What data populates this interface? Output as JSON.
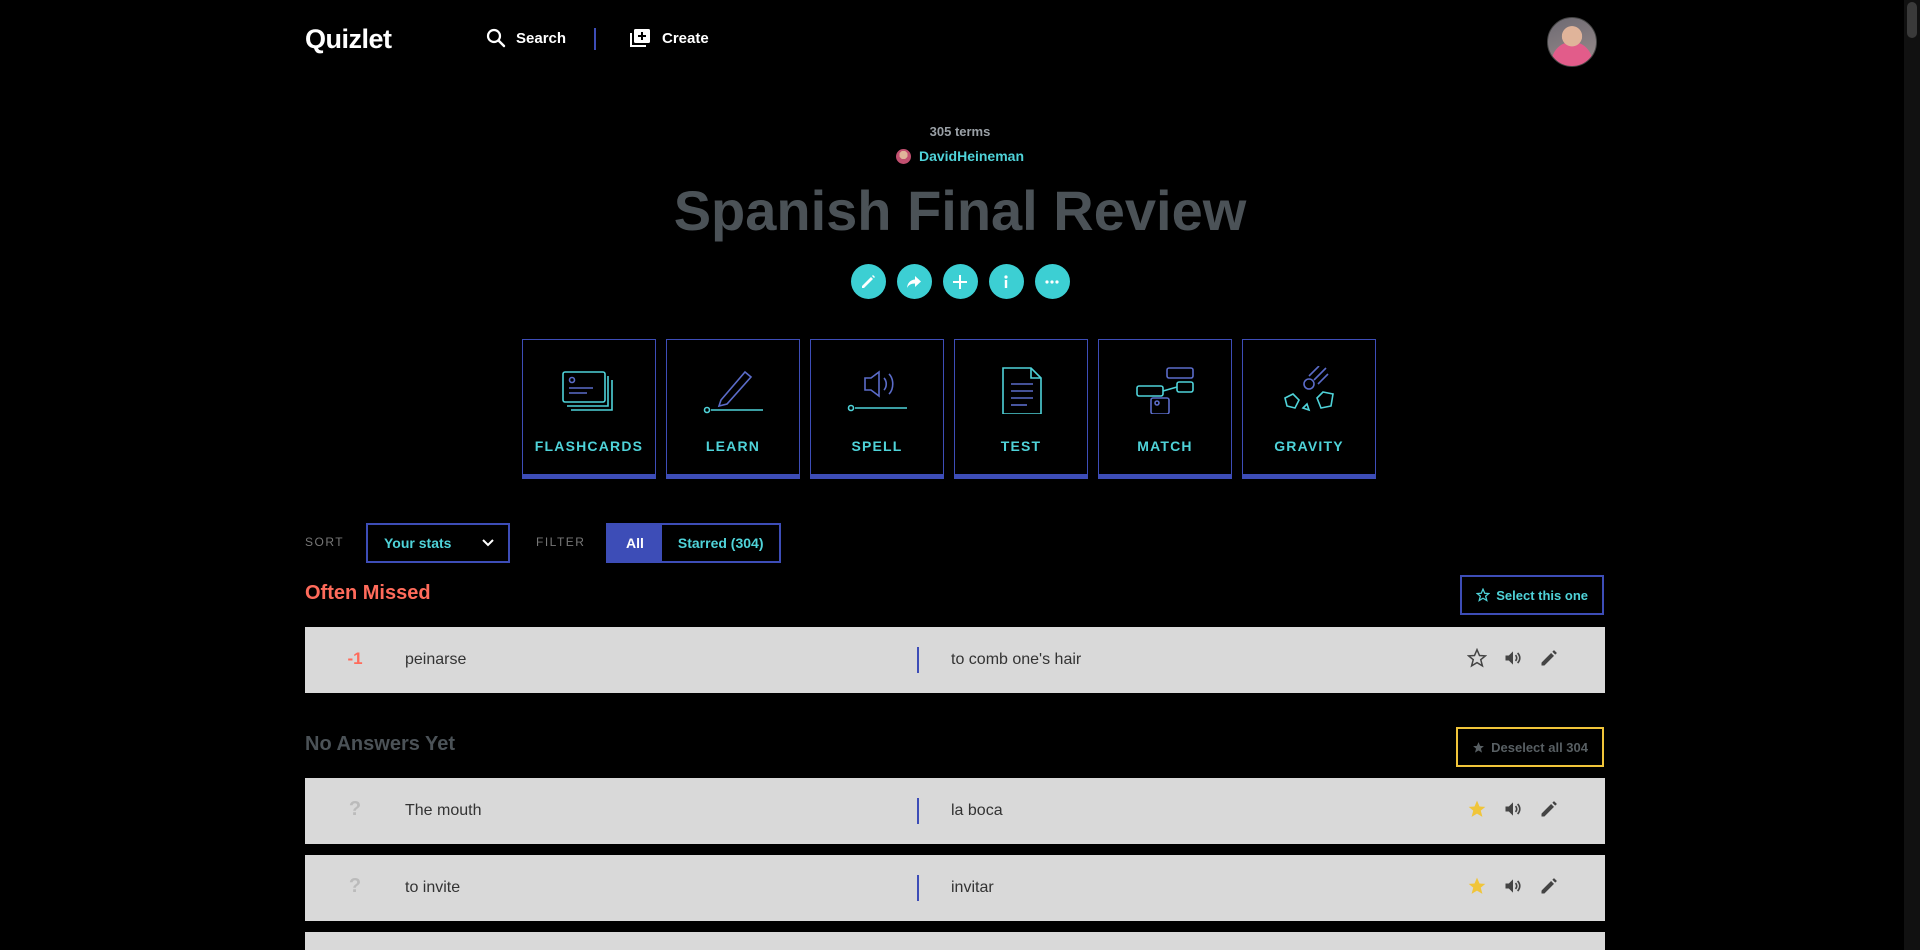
{
  "header": {
    "logo": "Quizlet",
    "search_label": "Search",
    "create_label": "Create"
  },
  "set": {
    "term_count": "305 terms",
    "author": "DavidHeineman",
    "title": "Spanish Final Review"
  },
  "modes": [
    {
      "label": "FLASHCARDS",
      "icon": "flashcards-icon"
    },
    {
      "label": "LEARN",
      "icon": "learn-icon"
    },
    {
      "label": "SPELL",
      "icon": "spell-icon"
    },
    {
      "label": "TEST",
      "icon": "test-icon"
    },
    {
      "label": "MATCH",
      "icon": "match-icon"
    },
    {
      "label": "GRAVITY",
      "icon": "gravity-icon"
    }
  ],
  "controls": {
    "sort_label": "SORT",
    "sort_value": "Your stats",
    "filter_label": "FILTER",
    "filter_all": "All",
    "filter_starred": "Starred (304)"
  },
  "sections": {
    "missed": {
      "title": "Often Missed",
      "button": "Select this one"
    },
    "no_answers": {
      "title": "No Answers Yet",
      "button": "Deselect all 304"
    }
  },
  "terms": [
    {
      "score": "-1",
      "term": "peinarse",
      "definition": "to comb one's hair",
      "starred": false
    },
    {
      "score": "?",
      "term": "The mouth",
      "definition": "la boca",
      "starred": true
    },
    {
      "score": "?",
      "term": "to invite",
      "definition": "invitar",
      "starred": true
    }
  ],
  "colors": {
    "accent": "#4fd3d9",
    "border": "#3d4db7",
    "missed": "#ff6b5b",
    "star": "#f0c53a"
  }
}
